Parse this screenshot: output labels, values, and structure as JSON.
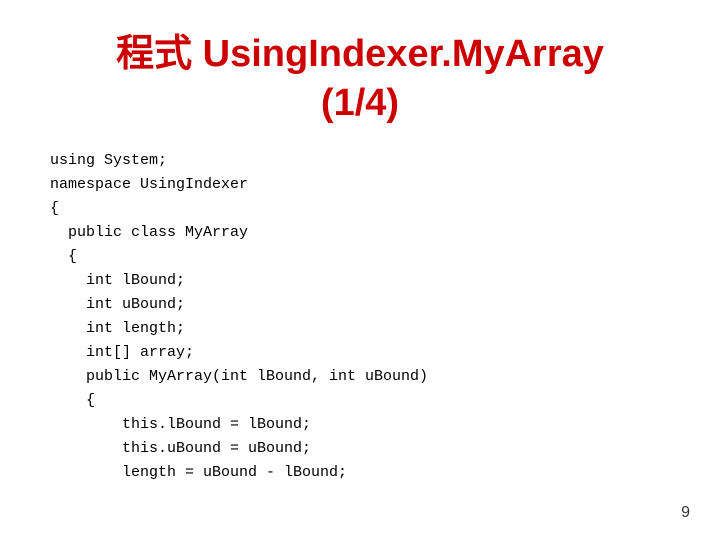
{
  "title": {
    "line1": "程式 UsingIndexer.MyArray",
    "line2": "(1/4)"
  },
  "code": {
    "lines": [
      "using System;",
      "namespace UsingIndexer",
      "{",
      "  public class MyArray",
      "  {",
      "    int lBound;",
      "    int uBound;",
      "    int length;",
      "    int[] array;",
      "    public MyArray(int lBound, int uBound)",
      "    {",
      "        this.lBound = lBound;",
      "        this.uBound = uBound;",
      "        length = uBound - lBound;"
    ]
  },
  "page_number": "9"
}
